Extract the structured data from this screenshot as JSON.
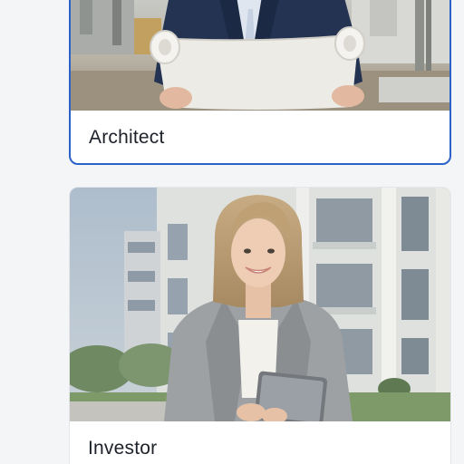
{
  "cards": [
    {
      "label": "Architect",
      "selected": true,
      "image": "architect-holding-blueprints-photo"
    },
    {
      "label": "Investor",
      "selected": false,
      "image": "investor-with-tablet-photo"
    }
  ],
  "colors": {
    "page_background": "#f4f5f7",
    "card_background": "#ffffff",
    "selected_border": "#2a62c9",
    "label_text": "#1d2129"
  }
}
